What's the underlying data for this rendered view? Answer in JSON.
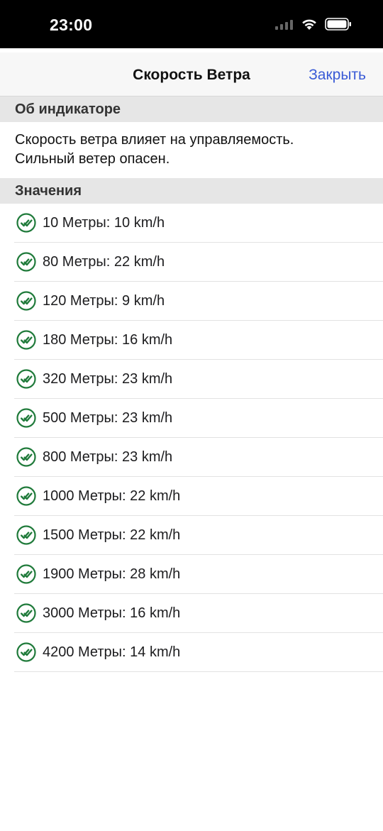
{
  "status_bar": {
    "time": "23:00",
    "icons": [
      "cellular-signal-icon",
      "wifi-icon",
      "battery-icon"
    ]
  },
  "navbar": {
    "title": "Скорость Ветра",
    "close_label": "Закрыть"
  },
  "about_section": {
    "header": "Об индикаторе",
    "text_line1": "Скорость ветра влияет на управляемость.",
    "text_line2": "Сильный ветер опасен."
  },
  "values_section": {
    "header": "Значения",
    "items": [
      {
        "label": "10 Метры: 10 km/h"
      },
      {
        "label": "80 Метры: 22 km/h"
      },
      {
        "label": "120 Метры: 9 km/h"
      },
      {
        "label": "180 Метры: 16 km/h"
      },
      {
        "label": "320 Метры: 23 km/h"
      },
      {
        "label": "500 Метры: 23 km/h"
      },
      {
        "label": "800 Метры: 23 km/h"
      },
      {
        "label": "1000 Метры: 22 km/h"
      },
      {
        "label": "1500 Метры: 22 km/h"
      },
      {
        "label": "1900 Метры: 28 km/h"
      },
      {
        "label": "3000 Метры: 16 km/h"
      },
      {
        "label": "4200 Метры: 14 km/h"
      }
    ]
  },
  "colors": {
    "accent": "#3a5bd6",
    "check_green": "#1f7a3a",
    "section_header_bg": "#e6e6e6"
  }
}
